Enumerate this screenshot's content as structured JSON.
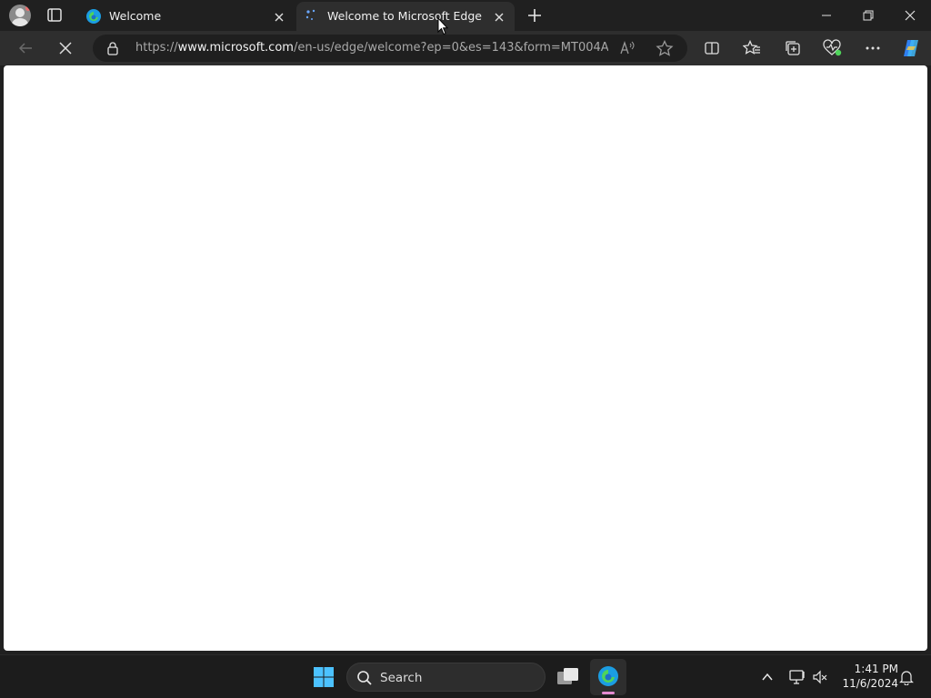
{
  "browser": {
    "tabs": [
      {
        "title": "Welcome",
        "active": false
      },
      {
        "title": "Welcome to Microsoft Edge",
        "active": true
      }
    ],
    "address": {
      "url_prefix": "https://",
      "url_domain": "www.microsoft.com",
      "url_path": "/en-us/edge/welcome?ep=0&es=143&form=MT004A..."
    }
  },
  "taskbar": {
    "search_label": "Search",
    "time": "1:41 PM",
    "date": "11/6/2024"
  },
  "colors": {
    "edge_blue": "#1b9de2",
    "edge_green": "#4fd45a",
    "content_bg": "#ffffff",
    "chrome_bg": "#202020"
  }
}
